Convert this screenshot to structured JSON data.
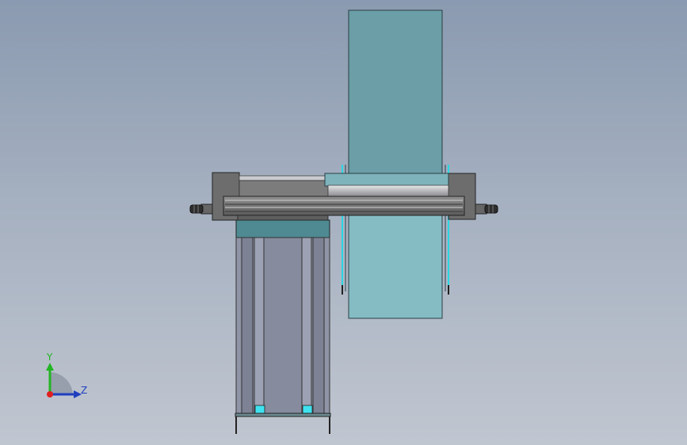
{
  "viewport": {
    "background_top": "#8a9ab0",
    "background_bottom": "#c0c6d0"
  },
  "model": {
    "panel_color": "#6b9ea6",
    "panel_lower_color": "#85bcc4",
    "cylinder_body_color": "#8f94a6",
    "frame_color": "#7a7a7a",
    "accent_cyan": "#3fe3f0"
  },
  "triad": {
    "y_label": "Y",
    "z_label": "Z",
    "y_color": "#22b522",
    "z_color": "#1f3fbf",
    "x_color": "#e02020"
  }
}
